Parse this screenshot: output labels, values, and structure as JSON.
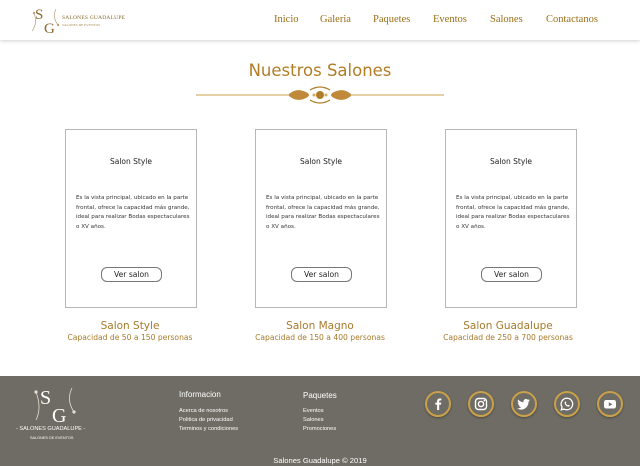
{
  "brand": {
    "monogram": "SG",
    "name": "SALONES GUADALUPE",
    "tagline": "SALONES DE EVENTOS"
  },
  "nav": {
    "items": [
      {
        "label": "Inicio"
      },
      {
        "label": "Galeria"
      },
      {
        "label": "Paquetes"
      },
      {
        "label": "Eventos"
      },
      {
        "label": "Salones"
      },
      {
        "label": "Contactanos"
      }
    ]
  },
  "main": {
    "title": "Nuestros Salones",
    "cards": [
      {
        "heading": "Salon Style",
        "description": "Es la vista principal, ubicado en la parte frontal, ofrece la capacidad más grande, ideal para realizar Bodas espectaculares o XV años.",
        "button": "Ver salon",
        "name": "Salon Style",
        "capacity": "Capacidad de 50 a 150 personas"
      },
      {
        "heading": "Salon Style",
        "description": "Es la vista principal, ubicado en la parte frontal, ofrece la capacidad más grande, ideal para realizar Bodas espectaculares o XV años.",
        "button": "Ver salon",
        "name": "Salon Magno",
        "capacity": "Capacidad de 150 a 400 personas"
      },
      {
        "heading": "Salon Style",
        "description": "Es la vista principal, ubicado en la parte frontal, ofrece la capacidad más grande, ideal para realizar Bodas espectaculares o XV años.",
        "button": "Ver salon",
        "name": "Salon Guadalupe",
        "capacity": "Capacidad de 250 a 700 personas"
      }
    ]
  },
  "footer": {
    "brand_name": "- SALONES GUADALUPE -",
    "brand_tagline": "SALONES DE EVENTOS",
    "informacion": {
      "heading": "Informacion",
      "links": [
        "Acerca de nosotros",
        "Politica de privacidad",
        "Terminos y condiciones"
      ]
    },
    "paquetes": {
      "heading": "Paquetes",
      "links": [
        "Eventos",
        "Salones",
        "Promociones"
      ]
    },
    "social": [
      "facebook-icon",
      "instagram-icon",
      "twitter-icon",
      "whatsapp-icon",
      "youtube-icon"
    ],
    "copyright": "Salones Guadalupe © 2019"
  },
  "colors": {
    "accent": "#b07d26",
    "footer_bg": "#6e6c64",
    "icon_ring": "#c9a14a"
  }
}
